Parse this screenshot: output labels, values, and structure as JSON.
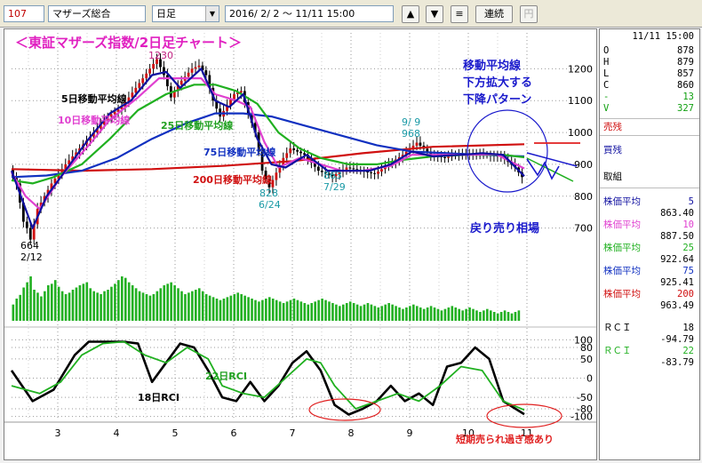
{
  "toolbar": {
    "code": "107",
    "name": "マザーズ総合",
    "period": "日足",
    "dropdown_glyph": "▼",
    "range": "2016/ 2/ 2 ～ 11/11 15:00",
    "up_label": "▲",
    "down_label": "▼",
    "menu_label": "≡",
    "renzoku_label": "連続",
    "yen_label": "円"
  },
  "side": {
    "date": "11/11 15:00",
    "ohlc": [
      {
        "k": "O",
        "v": "878"
      },
      {
        "k": "H",
        "v": "879"
      },
      {
        "k": "L",
        "v": "857"
      },
      {
        "k": "C",
        "v": "860"
      },
      {
        "k": "-",
        "v": "13"
      },
      {
        "k": "V",
        "v": "327"
      }
    ],
    "uri": "売残",
    "kai": "買残",
    "tori": "取組",
    "ma": [
      {
        "label": "株価平均",
        "period": "5",
        "value": "863.40",
        "color": "#1010a0"
      },
      {
        "label": "株価平均",
        "period": "10",
        "value": "887.50",
        "color": "#e040d0"
      },
      {
        "label": "株価平均",
        "period": "25",
        "value": "922.64",
        "color": "#20b020"
      },
      {
        "label": "株価平均",
        "period": "75",
        "value": "925.41",
        "color": "#1030c0"
      },
      {
        "label": "株価平均",
        "period": "200",
        "value": "963.49",
        "color": "#d01010"
      }
    ],
    "rci": [
      {
        "label": "ＲＣＩ",
        "period": "18",
        "value": "-94.79",
        "color": "#000000"
      },
      {
        "label": "ＲＣＩ",
        "period": "22",
        "value": "-83.79",
        "color": "#20b020"
      }
    ]
  },
  "annotations": {
    "main_title": "＜東証マザーズ指数/2日足チャート＞",
    "peak": "1230",
    "trough_value": "664",
    "trough_date": "2/12",
    "ma5": "5日移動平均線",
    "ma10": "10日移動平均線",
    "ma25": "25日移動平均線",
    "ma75": "75日移動平均線",
    "ma200": "200日移動平均線",
    "low1_value": "828",
    "low1_date": "6/24",
    "low2_value": "863",
    "low2_date": "7/29",
    "high3_date": "9/ 9",
    "high3_value": "968",
    "pattern_1": "移動平均線",
    "pattern_2": "下方拡大する",
    "pattern_3": "下降パターン",
    "modori": "戻り売り相場",
    "rci22": "22日RCI",
    "rci18": "18日RCI",
    "oversold": "短期売られ過ぎ感あり"
  },
  "chart_data": [
    {
      "type": "line",
      "title": "＜東証マザーズ指数/2日足チャート＞",
      "x_ticks": [
        "3",
        "4",
        "5",
        "6",
        "7",
        "8",
        "9",
        "10",
        "11"
      ],
      "y_ticks": [
        700,
        800,
        900,
        1000,
        1100,
        1200
      ],
      "ylim": [
        660,
        1240
      ],
      "ohlc_path": [
        [
          0,
          885
        ],
        [
          2,
          840
        ],
        [
          4,
          720
        ],
        [
          5,
          700
        ],
        [
          6,
          664
        ],
        [
          8,
          760
        ],
        [
          12,
          840
        ],
        [
          16,
          900
        ],
        [
          20,
          950
        ],
        [
          24,
          1000
        ],
        [
          28,
          1050
        ],
        [
          32,
          1080
        ],
        [
          36,
          1140
        ],
        [
          40,
          1200
        ],
        [
          42,
          1230
        ],
        [
          44,
          1180
        ],
        [
          46,
          1110
        ],
        [
          48,
          1150
        ],
        [
          52,
          1200
        ],
        [
          54,
          1210
        ],
        [
          56,
          1180
        ],
        [
          58,
          1100
        ],
        [
          60,
          1050
        ],
        [
          64,
          1120
        ],
        [
          66,
          1130
        ],
        [
          68,
          1060
        ],
        [
          70,
          1000
        ],
        [
          72,
          880
        ],
        [
          74,
          828
        ],
        [
          78,
          920
        ],
        [
          80,
          950
        ],
        [
          84,
          930
        ],
        [
          88,
          880
        ],
        [
          92,
          863
        ],
        [
          96,
          890
        ],
        [
          100,
          880
        ],
        [
          104,
          870
        ],
        [
          108,
          900
        ],
        [
          112,
          930
        ],
        [
          116,
          968
        ],
        [
          120,
          930
        ],
        [
          124,
          920
        ],
        [
          128,
          935
        ],
        [
          132,
          930
        ],
        [
          136,
          930
        ],
        [
          140,
          925
        ],
        [
          144,
          890
        ],
        [
          146,
          860
        ]
      ],
      "series": [
        {
          "name": "5日移動平均線",
          "color": "#1010a0",
          "values": [
            [
              0,
              880
            ],
            [
              4,
              760
            ],
            [
              6,
              700
            ],
            [
              10,
              800
            ],
            [
              16,
              890
            ],
            [
              22,
              980
            ],
            [
              28,
              1060
            ],
            [
              34,
              1100
            ],
            [
              40,
              1180
            ],
            [
              44,
              1190
            ],
            [
              48,
              1140
            ],
            [
              54,
              1200
            ],
            [
              58,
              1100
            ],
            [
              62,
              1080
            ],
            [
              66,
              1120
            ],
            [
              70,
              980
            ],
            [
              74,
              900
            ],
            [
              78,
              890
            ],
            [
              84,
              930
            ],
            [
              90,
              880
            ],
            [
              96,
              880
            ],
            [
              102,
              880
            ],
            [
              108,
              900
            ],
            [
              114,
              940
            ],
            [
              120,
              925
            ],
            [
              128,
              930
            ],
            [
              134,
              935
            ],
            [
              140,
              930
            ],
            [
              146,
              863
            ]
          ]
        },
        {
          "name": "10日移動平均線",
          "color": "#e040d0",
          "values": [
            [
              0,
              875
            ],
            [
              4,
              800
            ],
            [
              8,
              760
            ],
            [
              14,
              860
            ],
            [
              22,
              960
            ],
            [
              28,
              1040
            ],
            [
              36,
              1110
            ],
            [
              42,
              1170
            ],
            [
              48,
              1170
            ],
            [
              54,
              1170
            ],
            [
              58,
              1120
            ],
            [
              64,
              1100
            ],
            [
              68,
              1080
            ],
            [
              72,
              970
            ],
            [
              76,
              890
            ],
            [
              82,
              920
            ],
            [
              88,
              900
            ],
            [
              94,
              880
            ],
            [
              100,
              880
            ],
            [
              108,
              895
            ],
            [
              114,
              930
            ],
            [
              122,
              930
            ],
            [
              130,
              930
            ],
            [
              138,
              932
            ],
            [
              146,
              887
            ]
          ]
        },
        {
          "name": "25日移動平均線",
          "color": "#20b020",
          "values": [
            [
              0,
              850
            ],
            [
              6,
              840
            ],
            [
              12,
              860
            ],
            [
              20,
              900
            ],
            [
              28,
              980
            ],
            [
              36,
              1070
            ],
            [
              44,
              1120
            ],
            [
              52,
              1150
            ],
            [
              58,
              1150
            ],
            [
              64,
              1130
            ],
            [
              70,
              1090
            ],
            [
              76,
              1000
            ],
            [
              82,
              950
            ],
            [
              88,
              920
            ],
            [
              96,
              900
            ],
            [
              104,
              900
            ],
            [
              112,
              915
            ],
            [
              120,
              925
            ],
            [
              130,
              930
            ],
            [
              140,
              930
            ],
            [
              146,
              922
            ]
          ]
        },
        {
          "name": "75日移動平均線",
          "color": "#1030c0",
          "values": [
            [
              0,
              860
            ],
            [
              10,
              865
            ],
            [
              20,
              880
            ],
            [
              30,
              920
            ],
            [
              40,
              980
            ],
            [
              50,
              1030
            ],
            [
              58,
              1060
            ],
            [
              66,
              1060
            ],
            [
              74,
              1050
            ],
            [
              84,
              1020
            ],
            [
              94,
              990
            ],
            [
              104,
              960
            ],
            [
              114,
              940
            ],
            [
              124,
              935
            ],
            [
              134,
              930
            ],
            [
              146,
              925
            ]
          ]
        },
        {
          "name": "200日移動平均線",
          "color": "#d01010",
          "values": [
            [
              0,
              885
            ],
            [
              20,
              880
            ],
            [
              40,
              885
            ],
            [
              60,
              895
            ],
            [
              80,
              910
            ],
            [
              100,
              935
            ],
            [
              120,
              955
            ],
            [
              146,
              963
            ]
          ]
        }
      ]
    },
    {
      "type": "bar",
      "title": "",
      "values": [
        22,
        30,
        35,
        45,
        52,
        60,
        42,
        38,
        33,
        40,
        48,
        50,
        55,
        46,
        40,
        36,
        38,
        42,
        45,
        48,
        50,
        52,
        44,
        40,
        38,
        36,
        40,
        42,
        46,
        50,
        55,
        60,
        58,
        52,
        48,
        44,
        40,
        38,
        36,
        34,
        36,
        40,
        44,
        48,
        50,
        52,
        48,
        44,
        40,
        36,
        38,
        40,
        42,
        44,
        40,
        36,
        34,
        32,
        30,
        28,
        30,
        32,
        34,
        36,
        38,
        36,
        34,
        32,
        30,
        28,
        26,
        28,
        30,
        32,
        30,
        28,
        26,
        24,
        26,
        28,
        30,
        28,
        26,
        24,
        22,
        24,
        26,
        28,
        30,
        28,
        26,
        24,
        22,
        20,
        22,
        24,
        26,
        24,
        22,
        20,
        22,
        24,
        22,
        20,
        18,
        20,
        22,
        24,
        22,
        20,
        18,
        16,
        18,
        20,
        22,
        20,
        18,
        16,
        18,
        20,
        18,
        16,
        14,
        16,
        18,
        20,
        18,
        16,
        14,
        16,
        18,
        16,
        14,
        12,
        14,
        16,
        14,
        12,
        10,
        12,
        14,
        12,
        10,
        12,
        14
      ]
    },
    {
      "type": "line",
      "title": "",
      "y_ticks": [
        100,
        80,
        50,
        0,
        -50,
        -80,
        -100
      ],
      "ylim": [
        -110,
        110
      ],
      "series": [
        {
          "name": "18日RCI",
          "color": "#000000",
          "values": [
            [
              0,
              20
            ],
            [
              6,
              -60
            ],
            [
              12,
              -30
            ],
            [
              18,
              60
            ],
            [
              22,
              95
            ],
            [
              28,
              95
            ],
            [
              32,
              95
            ],
            [
              36,
              90
            ],
            [
              40,
              -10
            ],
            [
              44,
              40
            ],
            [
              48,
              90
            ],
            [
              52,
              80
            ],
            [
              56,
              20
            ],
            [
              60,
              -50
            ],
            [
              64,
              -60
            ],
            [
              68,
              -10
            ],
            [
              72,
              -60
            ],
            [
              76,
              -20
            ],
            [
              80,
              40
            ],
            [
              84,
              70
            ],
            [
              88,
              20
            ],
            [
              92,
              -70
            ],
            [
              96,
              -95
            ],
            [
              100,
              -80
            ],
            [
              104,
              -60
            ],
            [
              108,
              -20
            ],
            [
              112,
              -60
            ],
            [
              116,
              -40
            ],
            [
              120,
              -70
            ],
            [
              124,
              30
            ],
            [
              128,
              40
            ],
            [
              132,
              80
            ],
            [
              136,
              50
            ],
            [
              140,
              -60
            ],
            [
              146,
              -94
            ]
          ]
        },
        {
          "name": "22日RCI",
          "color": "#20b020",
          "values": [
            [
              0,
              -20
            ],
            [
              8,
              -40
            ],
            [
              14,
              -10
            ],
            [
              20,
              60
            ],
            [
              26,
              90
            ],
            [
              32,
              95
            ],
            [
              38,
              60
            ],
            [
              44,
              40
            ],
            [
              50,
              80
            ],
            [
              56,
              50
            ],
            [
              60,
              -20
            ],
            [
              66,
              -40
            ],
            [
              72,
              -50
            ],
            [
              78,
              0
            ],
            [
              84,
              50
            ],
            [
              88,
              40
            ],
            [
              92,
              -20
            ],
            [
              98,
              -80
            ],
            [
              104,
              -60
            ],
            [
              110,
              -40
            ],
            [
              116,
              -60
            ],
            [
              122,
              -20
            ],
            [
              128,
              30
            ],
            [
              134,
              20
            ],
            [
              140,
              -60
            ],
            [
              146,
              -83
            ]
          ]
        }
      ]
    }
  ]
}
